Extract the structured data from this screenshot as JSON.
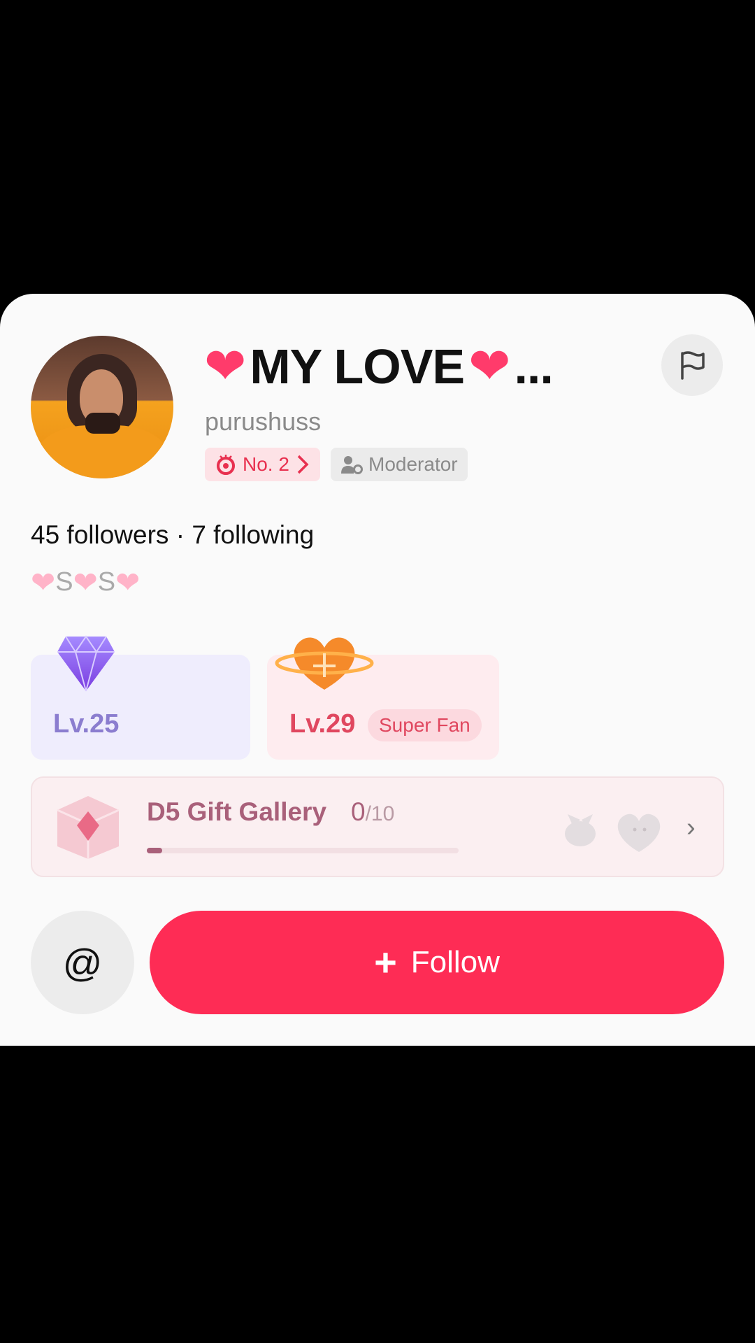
{
  "profile": {
    "display_name": "MY LOVE",
    "name_truncation": "...",
    "username": "purushuss",
    "rank_badge": "No. 2",
    "role_badge": "Moderator",
    "followers_text": "45 followers",
    "separator": "·",
    "following_text": "7 following",
    "bio_letter_1": "S",
    "bio_letter_2": "S"
  },
  "levels": {
    "gifter_level": "Lv.25",
    "fan_level": "Lv.29",
    "fan_badge": "Super Fan"
  },
  "gallery": {
    "title": "D5 Gift Gallery",
    "collected": "0",
    "total": "/10",
    "progress_fraction": 0.05
  },
  "actions": {
    "mention_symbol": "@",
    "follow_plus": "+",
    "follow_label": "Follow"
  },
  "colors": {
    "follow_button": "#fe2c55",
    "rank_badge_text": "#e8304f",
    "gallery_accent": "#a9607a"
  },
  "icons": [
    "flag-icon",
    "heart-icon",
    "rank-icon",
    "chevron-right-icon",
    "moderator-icon",
    "diamond-icon",
    "fan-heart-icon",
    "gift-box-icon",
    "at-icon",
    "plus-icon"
  ]
}
